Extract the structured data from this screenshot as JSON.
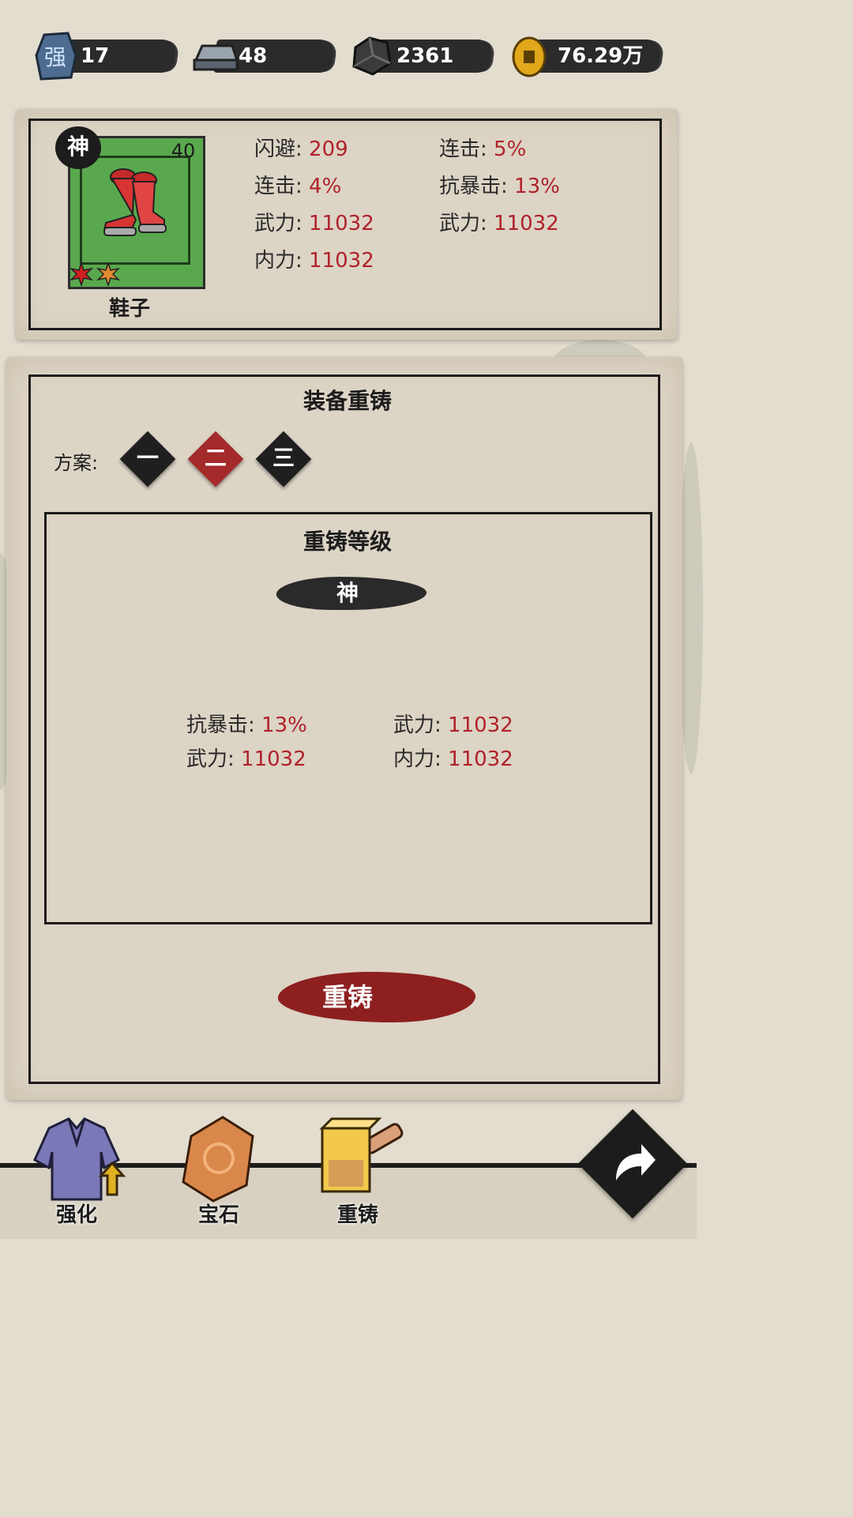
{
  "currencies": [
    {
      "icon": "strength-stone-icon",
      "value": "17",
      "glyph": "强"
    },
    {
      "icon": "iron-ingot-icon",
      "value": "48"
    },
    {
      "icon": "ore-icon",
      "value": "2361"
    },
    {
      "icon": "gold-coin-icon",
      "value": "76.29万"
    }
  ],
  "item": {
    "rarity": "神",
    "level": "40",
    "name": "鞋子",
    "icon": "boots-icon",
    "stats": [
      {
        "label": "闪避:",
        "value": "209"
      },
      {
        "label": "连击:",
        "value": "5%"
      },
      {
        "label": "连击:",
        "value": "4%"
      },
      {
        "label": "抗暴击:",
        "value": "13%"
      },
      {
        "label": "武力:",
        "value": "11032"
      },
      {
        "label": "武力:",
        "value": "11032"
      },
      {
        "label": "内力:",
        "value": "11032"
      }
    ]
  },
  "recast": {
    "title": "装备重铸",
    "scheme_label": "方案:",
    "schemes": [
      {
        "label": "一",
        "selected": false
      },
      {
        "label": "二",
        "selected": true
      },
      {
        "label": "三",
        "selected": false
      }
    ],
    "level_title": "重铸等级",
    "level_value": "神",
    "stats": [
      {
        "label": "抗暴击:",
        "value": "13%"
      },
      {
        "label": "武力:",
        "value": "11032"
      },
      {
        "label": "武力:",
        "value": "11032"
      },
      {
        "label": "内力:",
        "value": "11032"
      }
    ],
    "button_label": "重铸"
  },
  "tabs": [
    {
      "label": "强化",
      "icon": "robe-upgrade-icon"
    },
    {
      "label": "宝石",
      "icon": "gem-icon"
    },
    {
      "label": "重铸",
      "icon": "forge-hammer-icon"
    }
  ],
  "colors": {
    "accent_red": "#b0222a",
    "selected_scheme": "#a52a2a",
    "item_frame_green": "#5aa84e"
  }
}
